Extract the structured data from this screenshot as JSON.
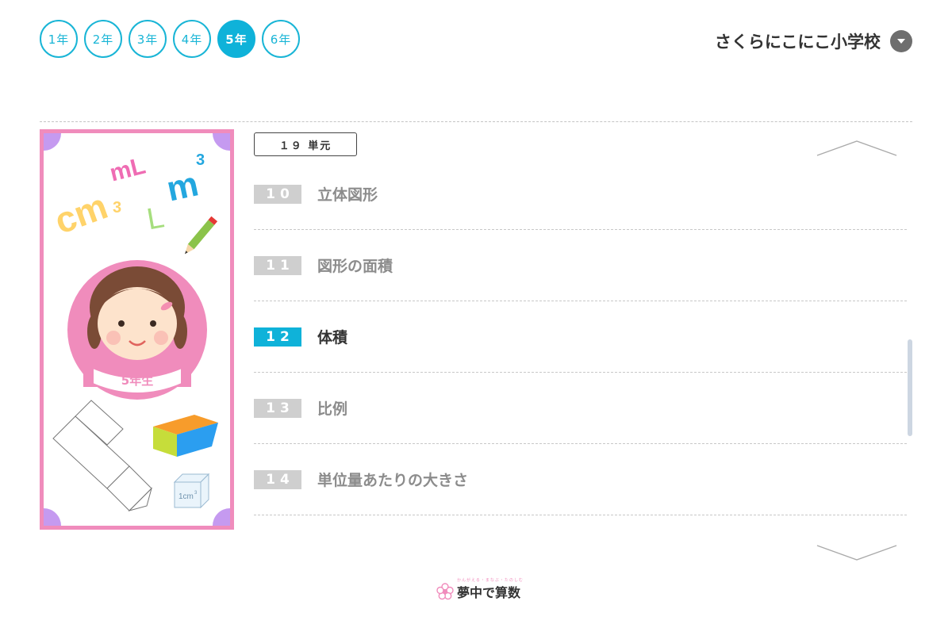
{
  "grade_tabs": [
    {
      "label": "1年",
      "active": false
    },
    {
      "label": "2年",
      "active": false
    },
    {
      "label": "3年",
      "active": false
    },
    {
      "label": "4年",
      "active": false
    },
    {
      "label": "5年",
      "active": true
    },
    {
      "label": "6年",
      "active": false
    }
  ],
  "school": {
    "name": "さくらにこにこ小学校",
    "dropdown_icon": "caret-down-icon"
  },
  "card": {
    "grade_ribbon": "5年生",
    "stickers": {
      "ml": "mL",
      "m3": "m",
      "m3_sup": "3",
      "cm3": "cm",
      "cm3_sup": "3",
      "l": "L",
      "cube": "1cm",
      "cube_sup": "3"
    },
    "colors": {
      "border": "#f08cbc",
      "corner": "#c59af0",
      "circle": "#f08cbc"
    }
  },
  "units": {
    "count_label": "１９ 単元",
    "items": [
      {
        "number": "10",
        "title": "立体図形",
        "active": false
      },
      {
        "number": "11",
        "title": "図形の面積",
        "active": false
      },
      {
        "number": "12",
        "title": "体積",
        "active": true
      },
      {
        "number": "13",
        "title": "比例",
        "active": false
      },
      {
        "number": "14",
        "title": "単位量あたりの大きさ",
        "active": false
      }
    ]
  },
  "footer": {
    "logo_name": "夢中で算数",
    "tagline": "かんがえる・まなぶ・たのしむ"
  },
  "colors": {
    "accent": "#0fb2d9",
    "inactive_badge": "#cfcfcf",
    "pink": "#f08cbc"
  }
}
